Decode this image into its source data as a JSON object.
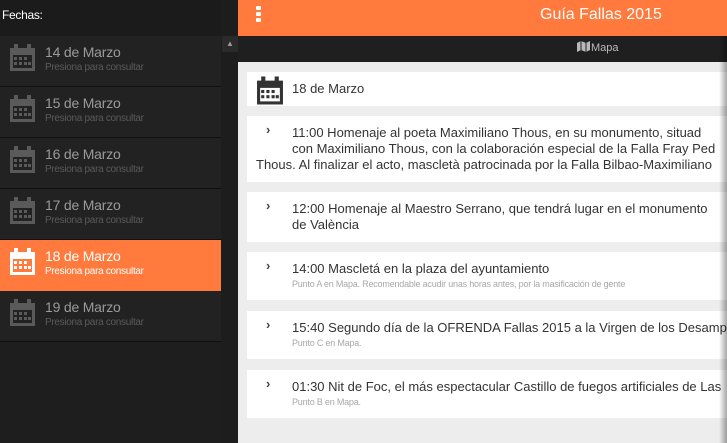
{
  "sidebar": {
    "header": "Fechas:",
    "items": [
      {
        "title": "14 de Marzo",
        "subtitle": "Presiona para consultar",
        "active": false
      },
      {
        "title": "15 de Marzo",
        "subtitle": "Presiona para consultar",
        "active": false
      },
      {
        "title": "16 de Marzo",
        "subtitle": "Presiona para consultar",
        "active": false
      },
      {
        "title": "17 de Marzo",
        "subtitle": "Presiona para consultar",
        "active": false
      },
      {
        "title": "18 de Marzo",
        "subtitle": "Presiona para consultar",
        "active": true
      },
      {
        "title": "19 de Marzo",
        "subtitle": "Presiona para consultar",
        "active": false
      }
    ]
  },
  "header": {
    "title": "Guía Fallas 2015",
    "map_label": "Mapa"
  },
  "day": {
    "label": "18 de Marzo"
  },
  "events": [
    {
      "line1": "11:00 Homenaje al poeta Maximiliano Thous, en su monumento, situad",
      "line2": "con Maximiliano Thous, con la colaboración especial de la Falla Fray Ped",
      "line3": "Thous. Al finalizar el acto, mascletà patrocinada por la Falla Bilbao-Maximiliano"
    },
    {
      "line1": "12:00 Homenaje al Maestro Serrano, que tendrá lugar en el monumento",
      "line2": "de València"
    },
    {
      "text": "14:00 Mascletá en la plaza del ayuntamiento",
      "note": "Punto A en Mapa. Recomendable acudir unas horas antes, por la masificación de gente"
    },
    {
      "text": "15:40 Segundo día de la OFRENDA Fallas 2015 a la Virgen de los Desamp",
      "note": "Punto C en Mapa."
    },
    {
      "text": "01:30 Nit de Foc, el más espectacular Castillo de fuegos artificiales de Las",
      "note": "Punto B en Mapa."
    }
  ],
  "colors": {
    "accent": "#ff7a3c",
    "sidebar_bg": "#222222",
    "content_bg": "#ededed"
  },
  "icons": {
    "calendar": "calendar-icon",
    "menu": "menu-icon",
    "map": "map-icon",
    "chevron": "chevron-right-icon"
  }
}
